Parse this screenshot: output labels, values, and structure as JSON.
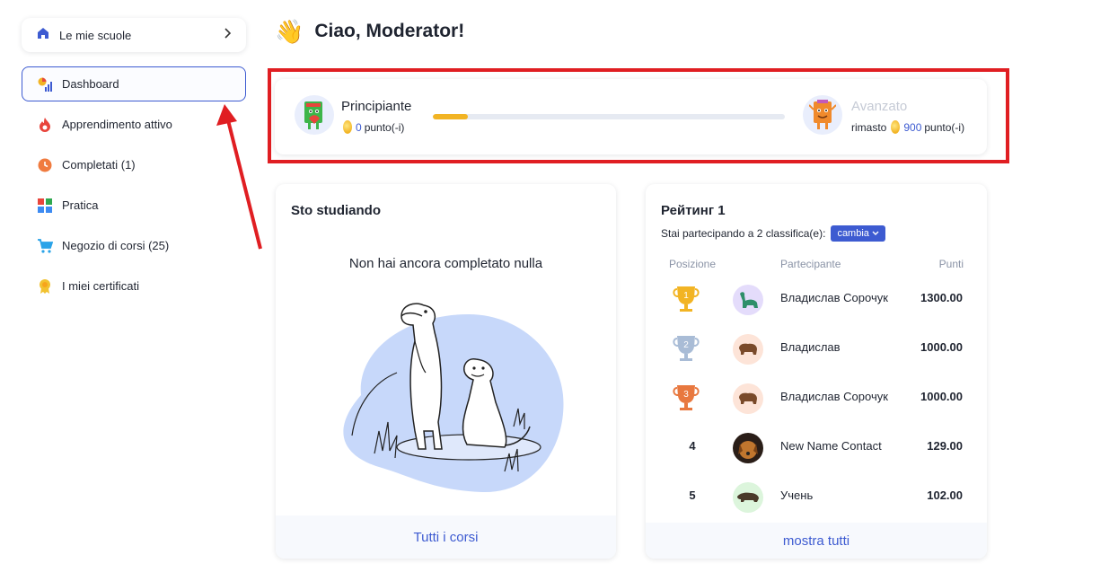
{
  "sidebar": {
    "school_label": "Le mie scuole",
    "items": [
      {
        "label": "Dashboard",
        "active": true,
        "icon": "dashboard-icon"
      },
      {
        "label": "Apprendimento attivo",
        "icon": "fire-icon"
      },
      {
        "label": "Completati (1)",
        "icon": "clock-icon"
      },
      {
        "label": "Pratica",
        "icon": "grid-icon"
      },
      {
        "label": "Negozio di corsi (25)",
        "icon": "cart-icon"
      },
      {
        "label": "I miei certificati",
        "icon": "certificate-icon"
      }
    ]
  },
  "greeting": {
    "emoji": "👋",
    "text": "Ciao, Moderator!"
  },
  "level": {
    "current": {
      "name": "Principiante",
      "points": "0",
      "points_unit": "punto(-i)"
    },
    "next": {
      "name": "Avanzato",
      "prefix": "rimasto",
      "points": "900",
      "points_unit": "punto(-i)"
    },
    "progress_percent": 10
  },
  "studying": {
    "title": "Sto studiando",
    "empty_message": "Non hai ancora completato nulla",
    "footer_link": "Tutti i corsi"
  },
  "rating": {
    "title": "Рейтинг 1",
    "subtitle": "Stai partecipando a 2 classifica(e):",
    "change_button": "cambia",
    "headers": {
      "position": "Posizione",
      "participant": "Partecipante",
      "points": "Punti"
    },
    "rows": [
      {
        "position": "1",
        "name": "Владислав Сорочук",
        "points": "1300.00"
      },
      {
        "position": "2",
        "name": "Владислав",
        "points": "1000.00"
      },
      {
        "position": "3",
        "name": "Владислав Сорочук",
        "points": "1000.00"
      },
      {
        "position": "4",
        "name": "New Name Contact",
        "points": "129.00"
      },
      {
        "position": "5",
        "name": "Учень",
        "points": "102.00"
      }
    ],
    "footer_link": "mostra tutti"
  },
  "colors": {
    "accent": "#3d5bd1",
    "highlight": "#e01e22",
    "progress": "#f2b424"
  }
}
